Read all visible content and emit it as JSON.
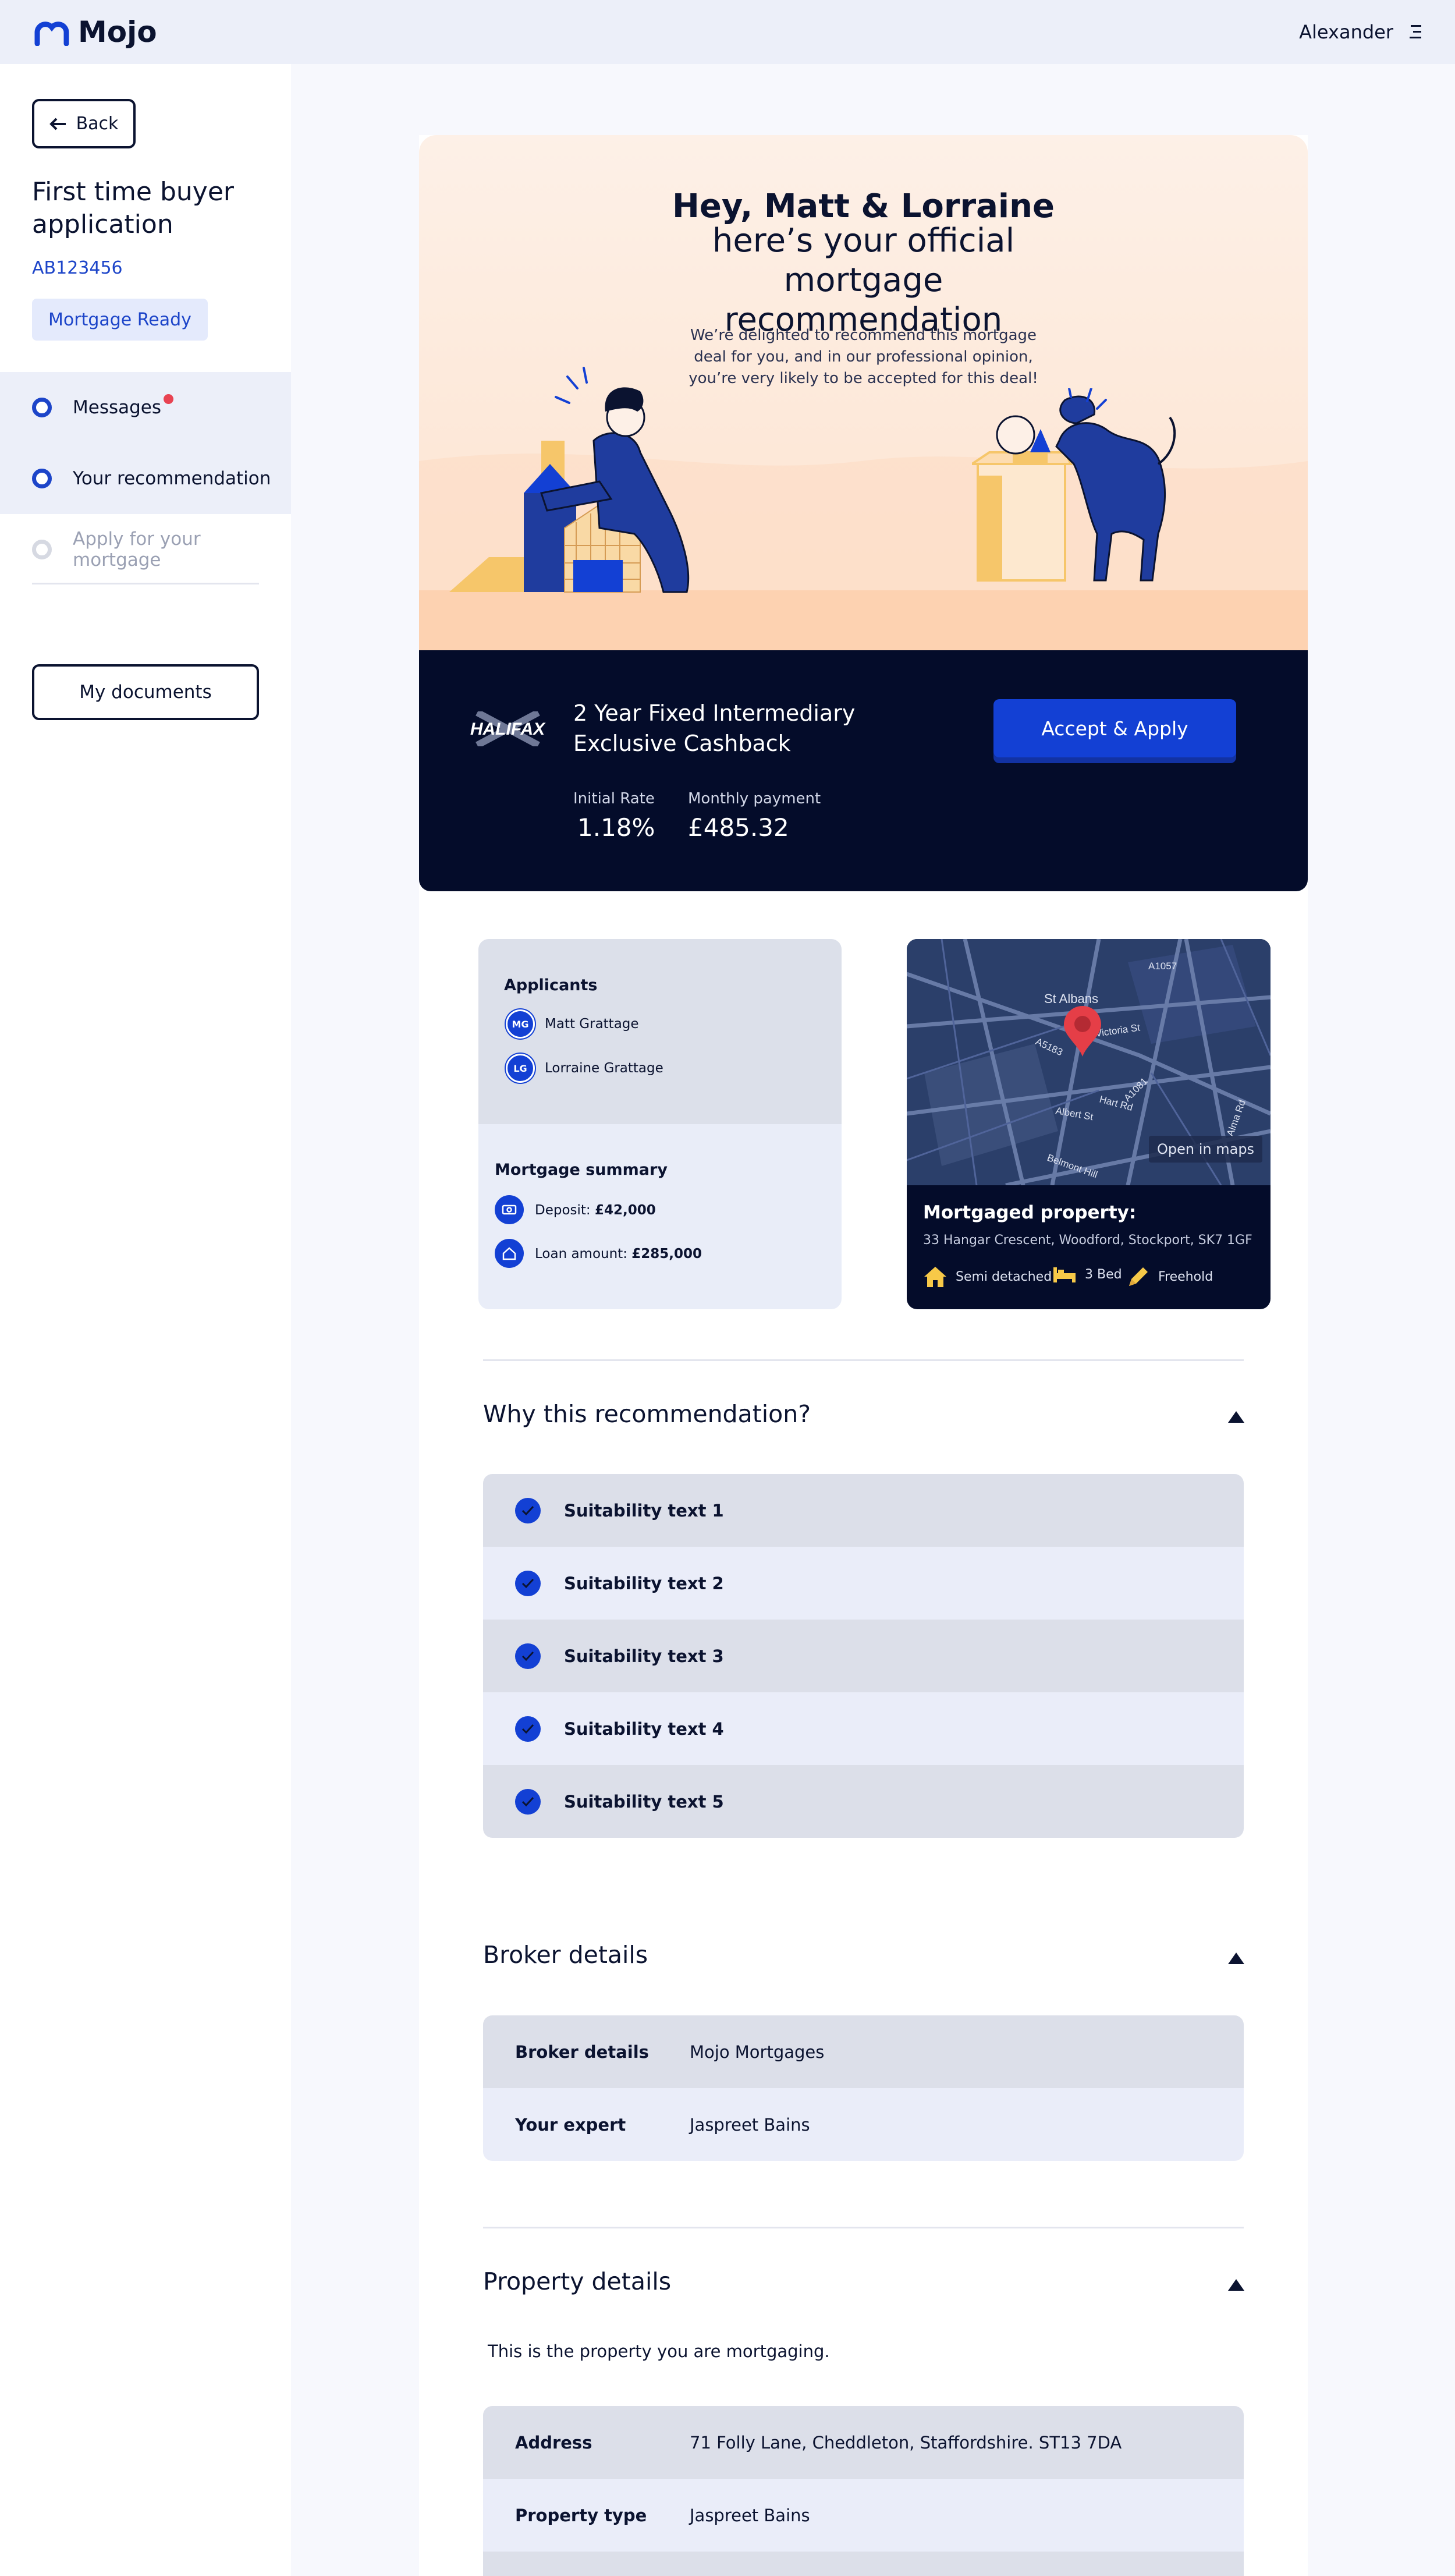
{
  "brand": {
    "name": "Mojo",
    "accent": "#1340d4",
    "navy": "#040c2a"
  },
  "header": {
    "user_name": "Alexander",
    "menu_icon": "hamburger-icon"
  },
  "sidebar": {
    "back_label": "Back",
    "title": "First time buyer application",
    "reference": "AB123456",
    "status_badge": "Mortgage Ready",
    "items": [
      {
        "label": "Messages",
        "state": "done",
        "has_notification": true
      },
      {
        "label": "Your recommendation",
        "state": "current"
      },
      {
        "label": "Apply for your mortgage",
        "state": "pending"
      }
    ],
    "documents_label": "My documents"
  },
  "hero": {
    "greeting": "Hey, Matt & Lorraine",
    "headline": "here’s your official mortgage recommendation",
    "intro": "We’re delighted to recommend this mortgage deal for you, and in our professional opinion, you’re very likely to be accepted for this deal!"
  },
  "deal": {
    "lender": "HALIFAX",
    "product_name": "2 Year Fixed Intermediary Exclusive Cashback",
    "cta_label": "Accept & Apply",
    "initial_rate_label": "Initial Rate",
    "initial_rate": "1.18%",
    "monthly_payment_label": "Monthly payment",
    "monthly_payment": "£485.32"
  },
  "applicants": {
    "heading": "Applicants",
    "people": [
      {
        "initials": "MG",
        "name": "Matt Grattage"
      },
      {
        "initials": "LG",
        "name": "Lorraine Grattage"
      }
    ]
  },
  "summary": {
    "heading": "Mortgage summary",
    "deposit_label": "Deposit:",
    "deposit": "£42,000",
    "loan_label": "Loan amount:",
    "loan": "£285,000"
  },
  "property_card": {
    "map_place": "St Albans",
    "map_street": "Victoria St",
    "map_labels": [
      "A1057",
      "A1081",
      "A5183",
      "Hart Rd",
      "Albert St",
      "Belmont Hill",
      "Alma Rd"
    ],
    "open_maps_label": "Open in maps",
    "heading": "Mortgaged property:",
    "address": "33 Hangar Crescent, Woodford, Stockport, SK7 1GF",
    "features": [
      "Semi detached",
      "3 Bed",
      "Freehold"
    ]
  },
  "why": {
    "title": "Why this recommendation?",
    "items": [
      "Suitability text 1",
      "Suitability text 2",
      "Suitability text 3",
      "Suitability text 4",
      "Suitability text 5"
    ]
  },
  "broker": {
    "title": "Broker details",
    "rows": [
      {
        "key": "Broker details",
        "value": "Mojo Mortgages"
      },
      {
        "key": "Your expert",
        "value": "Jaspreet Bains"
      }
    ]
  },
  "property": {
    "title": "Property details",
    "intro": "This is the property you are mortgaging.",
    "rows": [
      {
        "key": "Address",
        "value": "71 Folly Lane, Cheddleton, Staffordshire. ST13 7DA"
      },
      {
        "key": "Property type",
        "value": "Jaspreet Bains"
      }
    ]
  }
}
